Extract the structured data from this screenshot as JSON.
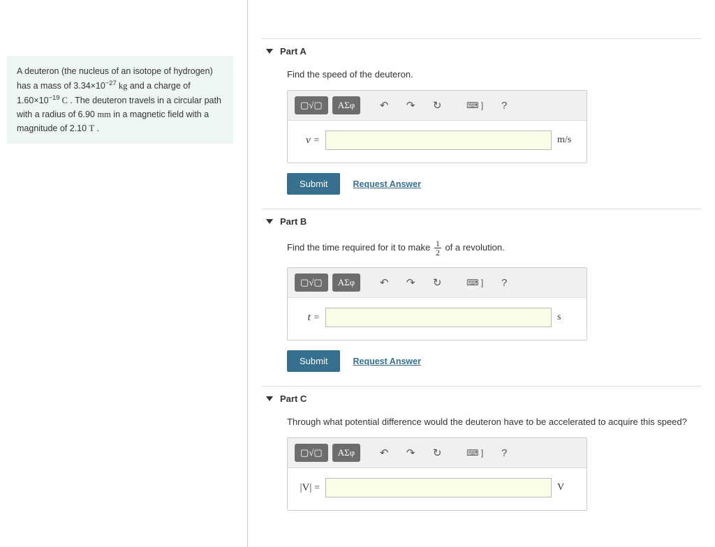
{
  "problem": {
    "text_before_mass": "A deuteron (the nucleus of an isotope of hydrogen) has a mass of 3.34×10",
    "mass_exp": "−27",
    "mass_unit": " kg",
    "text_after_mass": " and a charge of 1.60×10",
    "charge_exp": "−19",
    "charge_unit": " C",
    "text_after_charge": " . The deuteron travels in a circular path with a radius of 6.90 ",
    "radius_unit": "mm",
    "text_after_radius": " in a magnetic field with a magnitude of 2.10 ",
    "field_unit": "T",
    "period": " ."
  },
  "toolbar": {
    "template_label": "▢√▢",
    "greek_label": "ΑΣφ",
    "undo": "↶",
    "redo": "↷",
    "reset": "↻",
    "keyboard": "⌨ ]",
    "help": "?"
  },
  "actions": {
    "submit": "Submit",
    "request": "Request Answer"
  },
  "parts": {
    "a": {
      "title": "Part A",
      "prompt": "Find the speed of the deuteron.",
      "var": "v",
      "unit": "m/s"
    },
    "b": {
      "title": "Part B",
      "prompt_before": "Find the time required for it to make ",
      "frac_num": "1",
      "frac_den": "2",
      "prompt_after": " of a revolution.",
      "var": "t",
      "unit": "s"
    },
    "c": {
      "title": "Part C",
      "prompt": "Through what potential difference would the deuteron have to be accelerated to acquire this speed?",
      "var": "|V|",
      "unit": "V"
    }
  }
}
